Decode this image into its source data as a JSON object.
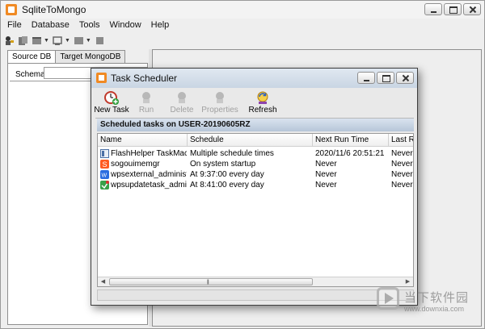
{
  "app": {
    "title": "SqliteToMongo",
    "menu": [
      "File",
      "Database",
      "Tools",
      "Window",
      "Help"
    ]
  },
  "left_panel": {
    "tabs": [
      "Source DB",
      "Target MongoDB"
    ],
    "active_tab": "Source DB",
    "schema_label": "Schema",
    "schema_value": ""
  },
  "dialog": {
    "title": "Task Scheduler",
    "toolbar": {
      "new_task": "New Task",
      "run": "Run",
      "delete": "Delete",
      "properties": "Properties",
      "refresh": "Refresh"
    },
    "header": "Scheduled tasks on USER-20190605RZ",
    "columns": [
      "Name",
      "Schedule",
      "Next Run Time",
      "Last Ru"
    ],
    "tasks": [
      {
        "name": "FlashHelper TaskMachi...",
        "schedule": "Multiple schedule times",
        "next_run": "2020/11/6 20:51:21",
        "last_run": "Never",
        "icon": "flash-task-icon"
      },
      {
        "name": "sogouimemgr",
        "schedule": "On system startup",
        "next_run": "Never",
        "last_run": "Never",
        "icon": "sogou-icon"
      },
      {
        "name": "wpsexternal_administr...",
        "schedule": "At 9:37:00 every day",
        "next_run": "Never",
        "last_run": "Never",
        "icon": "wps-icon"
      },
      {
        "name": "wpsupdatetask_admini...",
        "schedule": "At 8:41:00 every day",
        "next_run": "Never",
        "last_run": "Never",
        "icon": "wps-update-icon"
      }
    ]
  },
  "watermark": {
    "title": "当下软件园",
    "url": "www.downxia.com"
  },
  "colors": {
    "accent": "#f08a24",
    "dialog_title_bg": "#c9d5e3",
    "header_bg": "#b7c6d8"
  }
}
